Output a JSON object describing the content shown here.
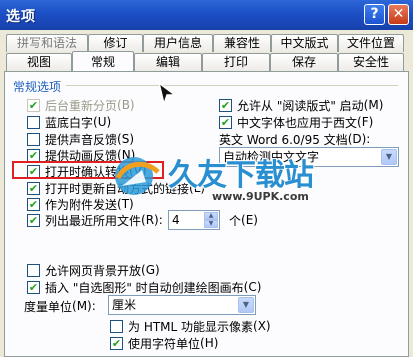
{
  "window": {
    "title": "选项",
    "help_label": "?",
    "close_label": "✕"
  },
  "tabs_back": [
    "拼写和语法",
    "修订",
    "用户信息",
    "兼容性",
    "中文版式",
    "文件位置"
  ],
  "tabs_front": [
    "视图",
    "常规",
    "编辑",
    "打印",
    "保存",
    "安全性"
  ],
  "active_tab": "常规",
  "group_label": "常规选项",
  "left_options": [
    {
      "label": "后台重新分页",
      "key": "(B)",
      "checked": true,
      "disabled": true
    },
    {
      "label": "蓝底白字",
      "key": "(U)",
      "checked": false,
      "disabled": false
    },
    {
      "label": "提供声音反馈",
      "key": "(S)",
      "checked": false,
      "disabled": false
    },
    {
      "label": "提供动画反馈",
      "key": "(N)",
      "checked": true,
      "disabled": false
    },
    {
      "label": "打开时确认转换",
      "key": "(V)",
      "checked": true,
      "disabled": false
    },
    {
      "label": "打开时更新自动方式的链接",
      "key": "(L)",
      "checked": true,
      "disabled": false
    },
    {
      "label": "作为附件发送",
      "key": "(T)",
      "checked": true,
      "disabled": false
    },
    {
      "label": "列出最近所用文件",
      "key": "(R):",
      "checked": true,
      "disabled": false
    }
  ],
  "recent_files": {
    "value": "4",
    "unit": "个",
    "unit_key": "(E)"
  },
  "right_options": [
    {
      "label": "允许从 \"阅读版式\" 启动",
      "key": "(M)",
      "checked": true
    },
    {
      "label": "中文字体也应用于西文",
      "key": "(F)",
      "checked": true
    }
  ],
  "english_word": {
    "label": "英文 Word 6.0/95 文档",
    "key": "(D):",
    "value": "自动检测中文文字"
  },
  "bottom_options": [
    {
      "label": "允许网页背景开放",
      "key": "(G)",
      "checked": false
    },
    {
      "label": "插入 \"自选图形\" 时自动创建绘图画布",
      "key": "(C)",
      "checked": true
    }
  ],
  "measure_unit": {
    "label": "度量单位",
    "key": "(M):",
    "value": "厘米"
  },
  "html_pixels": {
    "label": "为 HTML 功能显示像素",
    "key": "(X)",
    "checked": false
  },
  "char_units": {
    "label": "使用字符单位",
    "key": "(H)",
    "checked": true
  },
  "watermark": {
    "name": "久友下载站",
    "url": "www.9UPK.com"
  }
}
